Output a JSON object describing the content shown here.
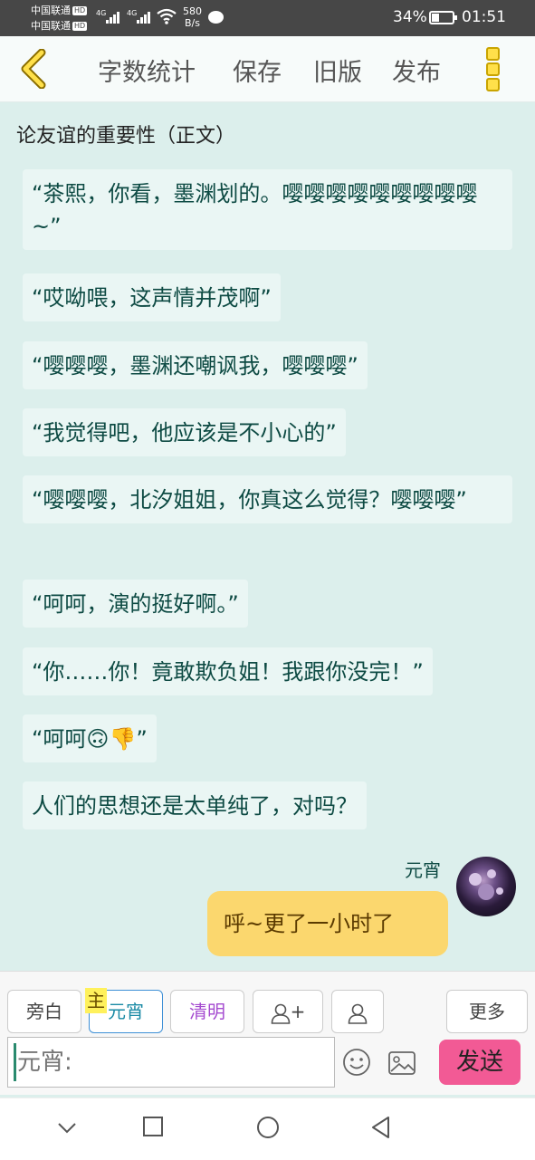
{
  "status_bar": {
    "carrier1": "中国联通",
    "carrier2": "中国联通",
    "hd": "HD",
    "net": "4G",
    "speed_value": "580",
    "speed_unit": "B/s",
    "battery": "34%",
    "time": "01:51"
  },
  "toolbar": {
    "word_count": "字数统计",
    "save": "保存",
    "old_version": "旧版",
    "publish": "发布"
  },
  "document": {
    "title": "论友谊的重要性（正文）"
  },
  "messages": [
    "“茶熙，你看，墨渊划的。嘤嘤嘤嘤嘤嘤嘤嘤嘤~”",
    "“哎呦喂，这声情并茂啊”",
    "“嘤嘤嘤，墨渊还嘲讽我，嘤嘤嘤”",
    "“我觉得吧，他应该是不小心的”",
    "“嘤嘤嘤，北汐姐姐，你真这么觉得？嘤嘤嘤”",
    "“呵呵，演的挺好啊。”",
    "“你……你！竟敢欺负姐！我跟你没完！”",
    "“呵呵🙃👎”",
    "人们的思想还是太单纯了，对吗？"
  ],
  "self_message": {
    "sender": "元宵",
    "text": "呼~更了一小时了"
  },
  "input_panel": {
    "narration": "旁白",
    "main_tag": "主",
    "character_yuanxiao": "元宵",
    "character_qingming": "清明",
    "add_character": "+",
    "more": "更多",
    "input_placeholder": "元宵:",
    "send": "发送"
  }
}
